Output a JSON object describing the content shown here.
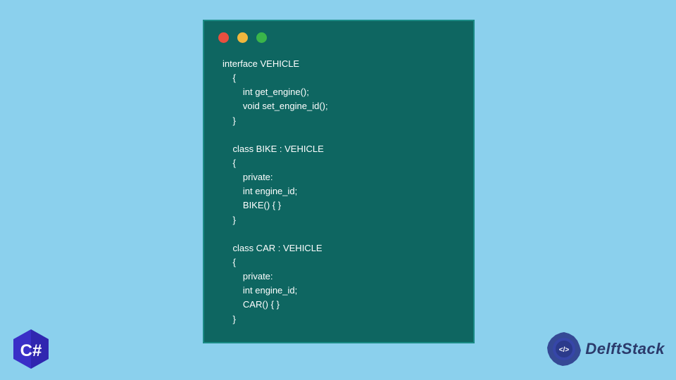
{
  "code": {
    "lines": [
      "interface VEHICLE",
      "    {",
      "        int get_engine();",
      "        void set_engine_id();",
      "    }",
      "",
      "    class BIKE : VEHICLE",
      "    {",
      "        private:",
      "        int engine_id;",
      "        BIKE() { }",
      "    }",
      "",
      "    class CAR : VEHICLE",
      "    {",
      "        private:",
      "        int engine_id;",
      "        CAR() { }",
      "    }"
    ]
  },
  "badges": {
    "csharp_label": "C#",
    "brand_name": "DelftStack"
  },
  "previewText": ""
}
